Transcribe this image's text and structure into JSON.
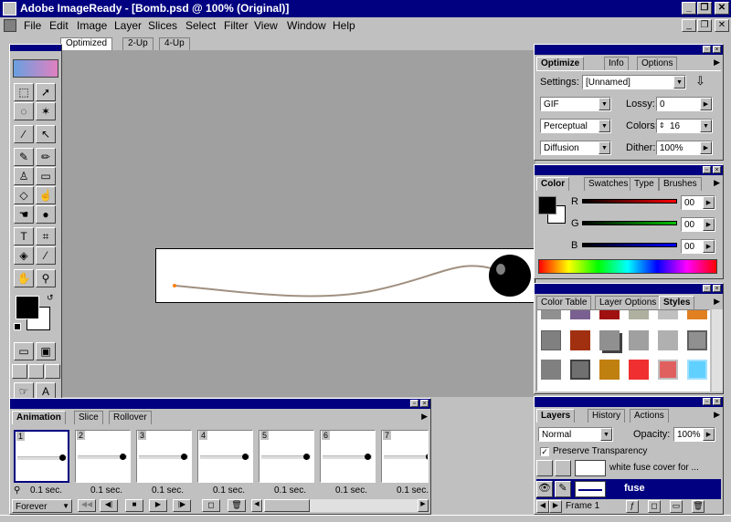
{
  "window": {
    "title": "Adobe ImageReady - [Bomb.psd @ 100% (Original)]",
    "min": "_",
    "restore": "❐",
    "close": "✕"
  },
  "menu": [
    "File",
    "Edit",
    "Image",
    "Layer",
    "Slices",
    "Select",
    "Filter",
    "View",
    "Window",
    "Help"
  ],
  "doc_tabs": [
    "Optimized",
    "2-Up",
    "4-Up"
  ],
  "optimize": {
    "tabs": [
      "Optimize",
      "Info",
      "Options"
    ],
    "settings_label": "Settings:",
    "settings_value": "[Unnamed]",
    "format": "GIF",
    "lossy_label": "Lossy:",
    "lossy_value": "0",
    "palette": "Perceptual",
    "colors_label": "Colors:",
    "colors_value": "16",
    "dither_method": "Diffusion",
    "dither_label": "Dither:",
    "dither_value": "100%"
  },
  "color": {
    "tabs": [
      "Color",
      "Swatches",
      "Type",
      "Brushes"
    ],
    "r_label": "R",
    "g_label": "G",
    "b_label": "B",
    "r_value": "00",
    "g_value": "00",
    "b_value": "00",
    "colors": {
      "r": "#ff0000",
      "g": "#00c000",
      "b": "#0000ff"
    }
  },
  "styles": {
    "tabs": [
      "Color Table",
      "Layer Options",
      "Styles"
    ]
  },
  "layers": {
    "tabs": [
      "Layers",
      "History",
      "Actions"
    ],
    "blend_mode": "Normal",
    "opacity_label": "Opacity:",
    "opacity_value": "100%",
    "preserve_label": "Preserve Transparency",
    "rows": [
      {
        "name": "white fuse cover for ..."
      },
      {
        "name": "fuse"
      }
    ],
    "frame_label": "Frame 1"
  },
  "animation": {
    "tabs": [
      "Animation",
      "Slice",
      "Rollover"
    ],
    "frames": [
      {
        "num": "1",
        "delay": "0.1 sec."
      },
      {
        "num": "2",
        "delay": "0.1 sec."
      },
      {
        "num": "3",
        "delay": "0.1 sec."
      },
      {
        "num": "4",
        "delay": "0.1 sec."
      },
      {
        "num": "5",
        "delay": "0.1 sec."
      },
      {
        "num": "6",
        "delay": "0.1 sec."
      },
      {
        "num": "7",
        "delay": "0.1 sec."
      }
    ],
    "loop": "Forever"
  },
  "icons": {
    "transport": [
      "first-frame-icon",
      "prev-frame-icon",
      "stop-icon",
      "play-icon",
      "next-frame-icon",
      "new-frame-icon",
      "trash-icon"
    ]
  }
}
